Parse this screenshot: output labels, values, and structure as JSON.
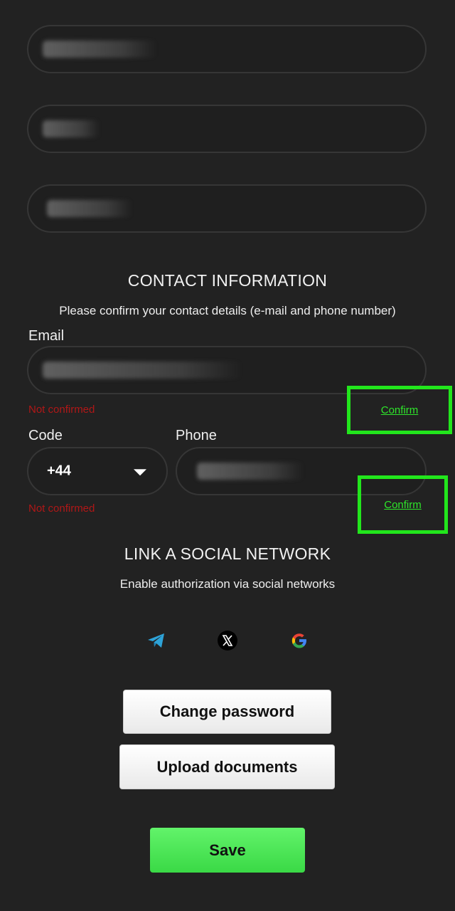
{
  "contact": {
    "title": "CONTACT INFORMATION",
    "subtitle": "Please confirm your contact details (e-mail and phone number)",
    "email_label": "Email",
    "email_status": "Not confirmed",
    "email_confirm": "Confirm",
    "code_label": "Code",
    "code_value": "+44",
    "phone_label": "Phone",
    "phone_status": "Not confirmed",
    "phone_confirm": "Confirm"
  },
  "social": {
    "title": "LINK A SOCIAL NETWORK",
    "subtitle": "Enable authorization via social networks",
    "icons": [
      "telegram-icon",
      "x-icon",
      "google-icon"
    ]
  },
  "buttons": {
    "change_password": "Change password",
    "upload_documents": "Upload documents",
    "save": "Save"
  },
  "colors": {
    "background": "#222222",
    "not_confirmed": "#b01717",
    "highlight": "#22e61c",
    "save_button": "#4ae556"
  }
}
